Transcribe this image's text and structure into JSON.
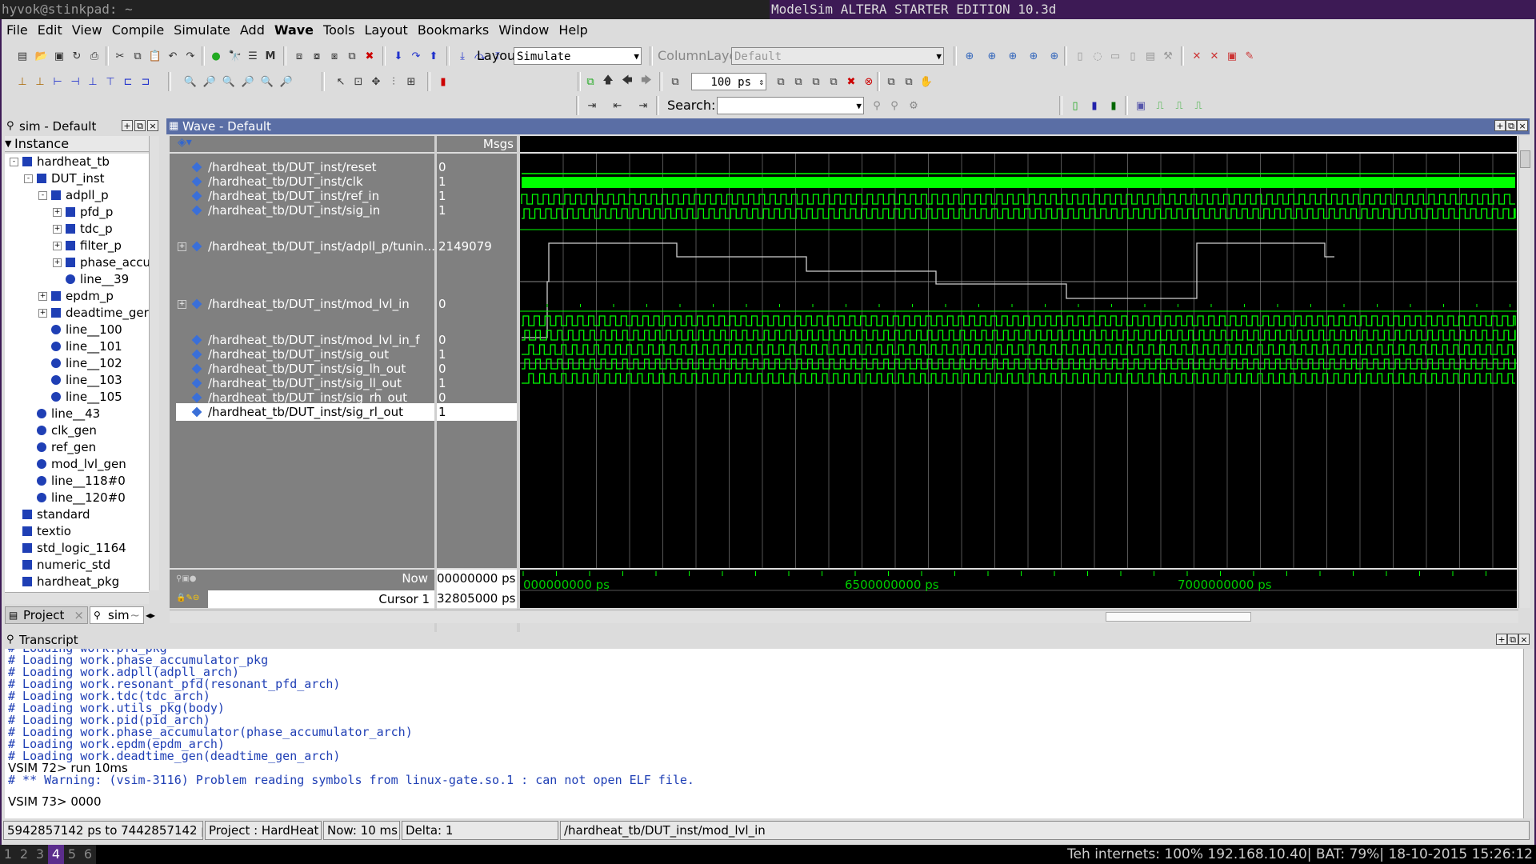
{
  "topbar": {
    "host": "hyvok@stinkpad: ~",
    "window_title": "ModelSim ALTERA STARTER EDITION 10.3d"
  },
  "menu": [
    "File",
    "Edit",
    "View",
    "Compile",
    "Simulate",
    "Add",
    "Wave",
    "Tools",
    "Layout",
    "Bookmarks",
    "Window",
    "Help"
  ],
  "toolbar": {
    "layout_label": "Layout",
    "layout_value": "Simulate",
    "column_layout_label": "ColumnLayout",
    "column_layout_value": "Default",
    "run_length": "100 ps",
    "search_label": "Search:"
  },
  "sim_panel": {
    "title": "sim - Default",
    "column_header": "Instance",
    "tree": [
      {
        "label": "hardheat_tb",
        "depth": 0,
        "exp": "-",
        "icon": "sq"
      },
      {
        "label": "DUT_inst",
        "depth": 1,
        "exp": "-",
        "icon": "sq"
      },
      {
        "label": "adpll_p",
        "depth": 2,
        "exp": "-",
        "icon": "sq"
      },
      {
        "label": "pfd_p",
        "depth": 3,
        "exp": "+",
        "icon": "sq"
      },
      {
        "label": "tdc_p",
        "depth": 3,
        "exp": "+",
        "icon": "sq"
      },
      {
        "label": "filter_p",
        "depth": 3,
        "exp": "+",
        "icon": "sq"
      },
      {
        "label": "phase_accu",
        "depth": 3,
        "exp": "+",
        "icon": "sq"
      },
      {
        "label": "line__39",
        "depth": 3,
        "exp": "",
        "icon": "dot"
      },
      {
        "label": "epdm_p",
        "depth": 2,
        "exp": "+",
        "icon": "sq"
      },
      {
        "label": "deadtime_ger",
        "depth": 2,
        "exp": "+",
        "icon": "sq"
      },
      {
        "label": "line__100",
        "depth": 2,
        "exp": "",
        "icon": "dot"
      },
      {
        "label": "line__101",
        "depth": 2,
        "exp": "",
        "icon": "dot"
      },
      {
        "label": "line__102",
        "depth": 2,
        "exp": "",
        "icon": "dot"
      },
      {
        "label": "line__103",
        "depth": 2,
        "exp": "",
        "icon": "dot"
      },
      {
        "label": "line__105",
        "depth": 2,
        "exp": "",
        "icon": "dot"
      },
      {
        "label": "line__43",
        "depth": 1,
        "exp": "",
        "icon": "dot"
      },
      {
        "label": "clk_gen",
        "depth": 1,
        "exp": "",
        "icon": "dot"
      },
      {
        "label": "ref_gen",
        "depth": 1,
        "exp": "",
        "icon": "dot"
      },
      {
        "label": "mod_lvl_gen",
        "depth": 1,
        "exp": "",
        "icon": "dot"
      },
      {
        "label": "line__118#0",
        "depth": 1,
        "exp": "",
        "icon": "dot"
      },
      {
        "label": "line__120#0",
        "depth": 1,
        "exp": "",
        "icon": "dot"
      },
      {
        "label": "standard",
        "depth": 0,
        "exp": "",
        "icon": "sq"
      },
      {
        "label": "textio",
        "depth": 0,
        "exp": "",
        "icon": "sq"
      },
      {
        "label": "std_logic_1164",
        "depth": 0,
        "exp": "",
        "icon": "sq"
      },
      {
        "label": "numeric_std",
        "depth": 0,
        "exp": "",
        "icon": "sq"
      },
      {
        "label": "hardheat_pkg",
        "depth": 0,
        "exp": "",
        "icon": "sq"
      }
    ],
    "tabs": [
      "Project",
      "sim"
    ]
  },
  "wave_panel": {
    "title": "Wave - Default",
    "msgs_header": "Msgs",
    "signals": [
      {
        "name": "/hardheat_tb/DUT_inst/reset",
        "value": "0"
      },
      {
        "name": "/hardheat_tb/DUT_inst/clk",
        "value": "1"
      },
      {
        "name": "/hardheat_tb/DUT_inst/ref_in",
        "value": "1"
      },
      {
        "name": "/hardheat_tb/DUT_inst/sig_in",
        "value": "1"
      },
      {
        "name": "/hardheat_tb/DUT_inst/adpll_p/tunin...",
        "value": "2149079"
      },
      {
        "name": "/hardheat_tb/DUT_inst/mod_lvl_in",
        "value": "0"
      },
      {
        "name": "/hardheat_tb/DUT_inst/mod_lvl_in_f",
        "value": "0"
      },
      {
        "name": "/hardheat_tb/DUT_inst/sig_out",
        "value": "1"
      },
      {
        "name": "/hardheat_tb/DUT_inst/sig_lh_out",
        "value": "0"
      },
      {
        "name": "/hardheat_tb/DUT_inst/sig_ll_out",
        "value": "1"
      },
      {
        "name": "/hardheat_tb/DUT_inst/sig_rh_out",
        "value": "0"
      },
      {
        "name": "/hardheat_tb/DUT_inst/sig_rl_out",
        "value": "1"
      }
    ],
    "now_label": "Now",
    "now_value": "00000000 ps",
    "cursor_label": "Cursor 1",
    "cursor_value": "32805000 ps",
    "time_ticks": [
      "000000000 ps",
      "6500000000 ps",
      "7000000000 ps"
    ]
  },
  "transcript": {
    "title": "Transcript",
    "lines": [
      {
        "text": "# Loading work.pfd_pkg",
        "cls": ""
      },
      {
        "text": "# Loading work.phase_accumulator_pkg",
        "cls": ""
      },
      {
        "text": "# Loading work.adpll(adpll_arch)",
        "cls": ""
      },
      {
        "text": "# Loading work.resonant_pfd(resonant_pfd_arch)",
        "cls": ""
      },
      {
        "text": "# Loading work.tdc(tdc_arch)",
        "cls": ""
      },
      {
        "text": "# Loading work.utils_pkg(body)",
        "cls": ""
      },
      {
        "text": "# Loading work.pid(pid_arch)",
        "cls": ""
      },
      {
        "text": "# Loading work.phase_accumulator(phase_accumulator_arch)",
        "cls": ""
      },
      {
        "text": "# Loading work.epdm(epdm_arch)",
        "cls": ""
      },
      {
        "text": "# Loading work.deadtime_gen(deadtime_gen_arch)",
        "cls": ""
      },
      {
        "text": "VSIM 72> run 10ms",
        "cls": "black"
      },
      {
        "text": "# ** Warning: (vsim-3116) Problem reading symbols from linux-gate.so.1 : can not open ELF file.",
        "cls": ""
      },
      {
        "text": "",
        "cls": ""
      },
      {
        "text": "VSIM 73> 0000",
        "cls": "black"
      }
    ]
  },
  "statusbar": {
    "range": "5942857142 ps to 7442857142 p",
    "project": "Project : HardHeat",
    "now": "Now: 10 ms",
    "delta": "Delta: 1",
    "path": "/hardheat_tb/DUT_inst/mod_lvl_in"
  },
  "bottombar": {
    "workspaces": [
      "1",
      "2",
      "3",
      "4",
      "5",
      "6"
    ],
    "active_workspace": "4",
    "sysinfo": "Teh internets: 100% 192.168.10.40| BAT: 79%| 18-10-2015 15:26:12"
  },
  "colors": {
    "wave_green": "#00ff00",
    "panel_title": "#5a6ea5",
    "window_border": "#3d1a55"
  }
}
